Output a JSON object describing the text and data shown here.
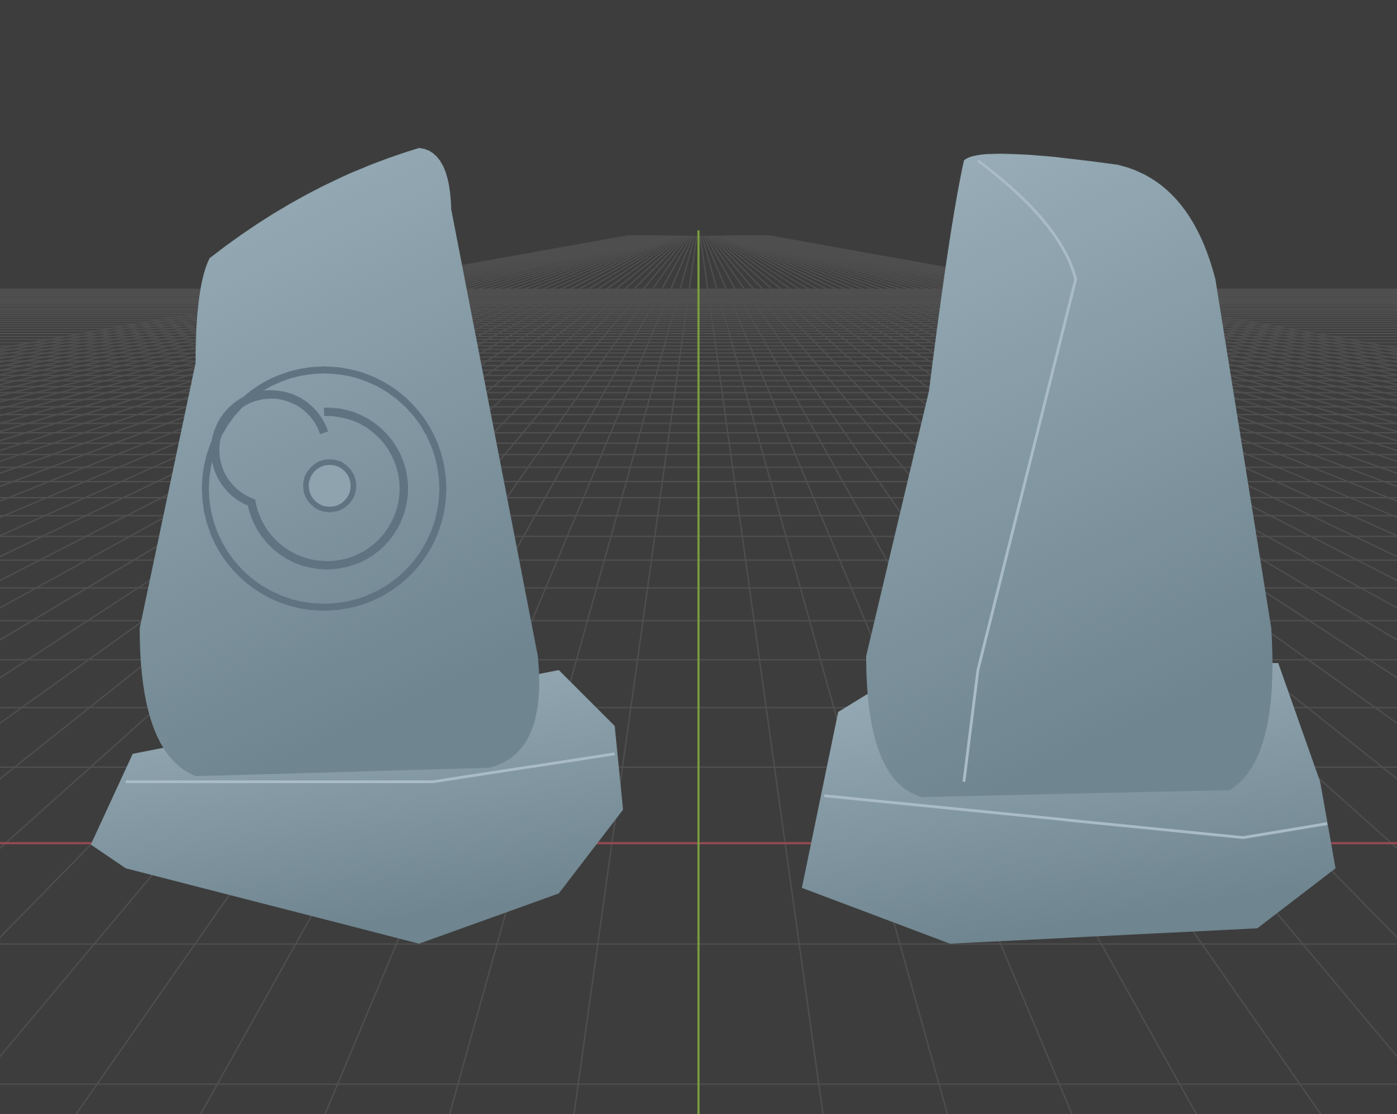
{
  "viewport": {
    "objects": [
      {
        "kind": "spiral-stone"
      },
      {
        "kind": "plain-stone"
      }
    ]
  }
}
